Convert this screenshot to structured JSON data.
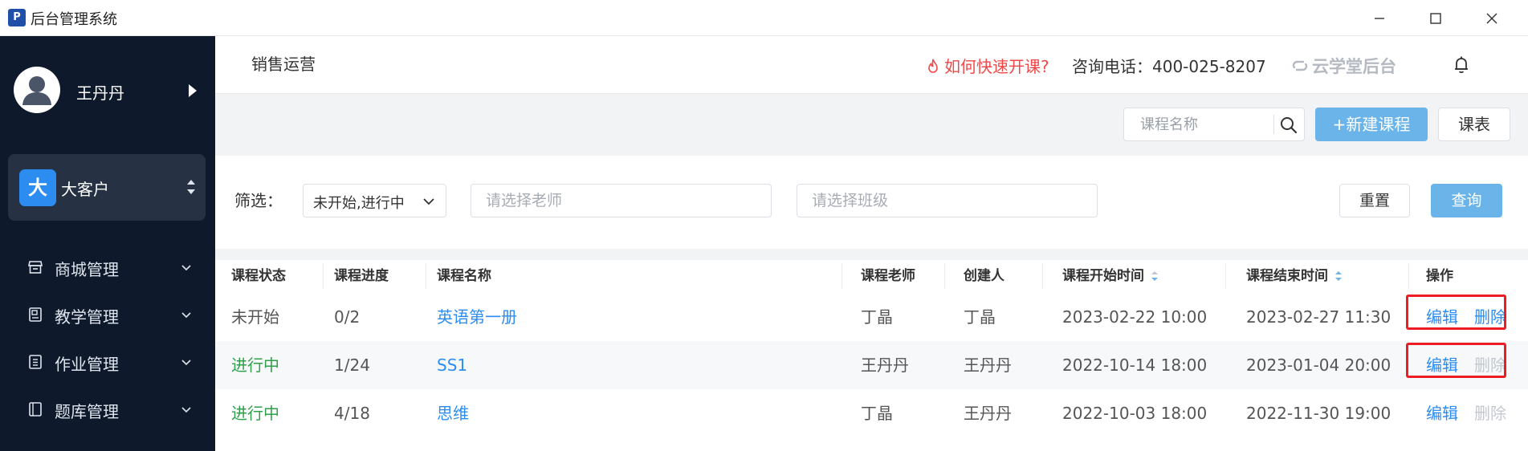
{
  "window": {
    "title": "后台管理系统",
    "app_icon_letter": "P"
  },
  "sidebar": {
    "user_name": "王丹丹",
    "org": {
      "badge": "大",
      "name": "大客户"
    },
    "items": [
      {
        "label": "商城管理",
        "icon": "store-icon"
      },
      {
        "label": "教学管理",
        "icon": "book-icon"
      },
      {
        "label": "作业管理",
        "icon": "homework-icon"
      },
      {
        "label": "题库管理",
        "icon": "question-bank-icon"
      }
    ]
  },
  "header": {
    "title": "销售运营",
    "quick_link": "如何快速开课?",
    "phone": "咨询电话：400-025-8207",
    "brand": "云学堂后台"
  },
  "toolbar": {
    "search_placeholder": "课程名称",
    "new_button": "+新建课程",
    "schedule_button": "课表"
  },
  "filter": {
    "label": "筛选：",
    "status_value": "未开始,进行中",
    "teacher_placeholder": "请选择老师",
    "class_placeholder": "请选择班级",
    "reset_button": "重置",
    "query_button": "查询"
  },
  "table": {
    "columns": [
      "课程状态",
      "课程进度",
      "课程名称",
      "课程老师",
      "创建人",
      "课程开始时间",
      "课程结束时间",
      "操作"
    ],
    "rows": [
      {
        "status": "未开始",
        "status_type": "pending",
        "progress": "0/2",
        "name": "英语第一册",
        "teacher": "丁晶",
        "creator": "丁晶",
        "start": "2023-02-22 10:00",
        "end": "2023-02-27 11:30",
        "edit": "编辑",
        "delete": "删除",
        "delete_enabled": true
      },
      {
        "status": "进行中",
        "status_type": "active",
        "progress": "1/24",
        "name": "SS1",
        "teacher": "王丹丹",
        "creator": "王丹丹",
        "start": "2022-10-14 18:00",
        "end": "2023-01-04 20:00",
        "edit": "编辑",
        "delete": "删除",
        "delete_enabled": false
      },
      {
        "status": "进行中",
        "status_type": "active",
        "progress": "4/18",
        "name": "思维",
        "teacher": "丁晶",
        "creator": "王丹丹",
        "start": "2022-10-03 18:00",
        "end": "2022-11-30 19:00",
        "edit": "编辑",
        "delete": "删除",
        "delete_enabled": false
      }
    ]
  },
  "colors": {
    "sidebar_bg": "#0e1a2b",
    "accent": "#2d8cf0",
    "primary_button": "#6ab4ea",
    "active_status": "#2fa04a",
    "warning": "#f04848",
    "highlight": "#ee1c25"
  }
}
